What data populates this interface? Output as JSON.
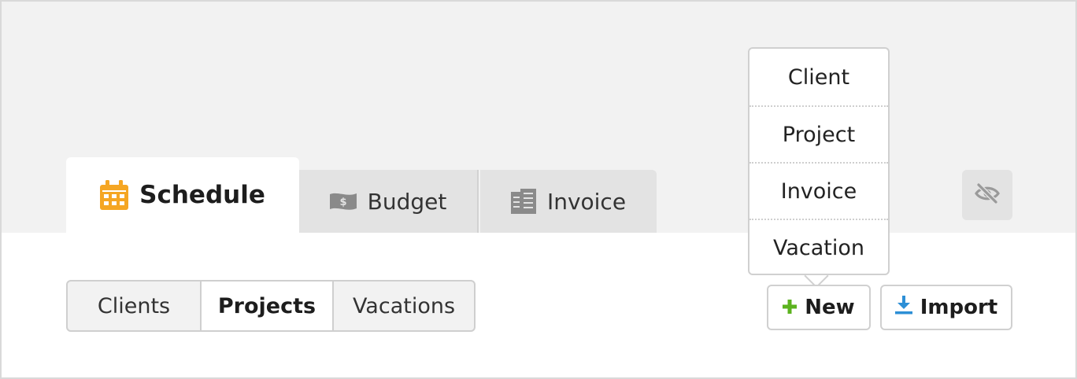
{
  "tabs": {
    "schedule": {
      "label": "Schedule",
      "icon": "calendar-icon",
      "color": "#f5a623"
    },
    "budget": {
      "label": "Budget",
      "icon": "money-icon"
    },
    "invoice": {
      "label": "Invoice",
      "icon": "document-icon"
    }
  },
  "segments": {
    "clients": "Clients",
    "projects": "Projects",
    "vacations": "Vacations",
    "selected": "Projects"
  },
  "actions": {
    "new_label": "New",
    "new_icon_color": "#5cb31f",
    "import_label": "Import",
    "import_icon_color": "#2d8fd6",
    "hide_icon": "eye-slash-icon"
  },
  "new_menu": {
    "items": [
      "Client",
      "Project",
      "Invoice",
      "Vacation"
    ]
  }
}
